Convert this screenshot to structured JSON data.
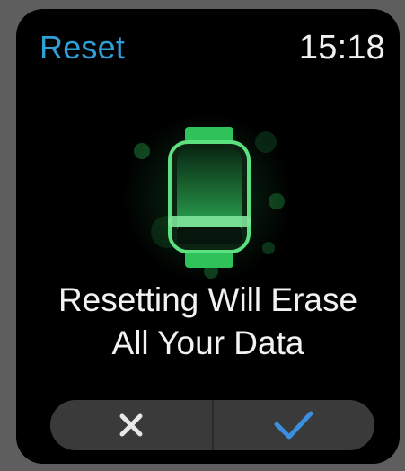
{
  "header": {
    "title": "Reset",
    "time": "15:18"
  },
  "message": {
    "line1": "Resetting Will Erase",
    "line2": "All Your Data"
  },
  "actions": {
    "cancel_icon": "close-icon",
    "confirm_icon": "checkmark-icon"
  },
  "colors": {
    "title": "#2f9fd8",
    "accent_green": "#2fc25a",
    "confirm": "#3a8fe0",
    "cancel": "#e8e8e8"
  },
  "illustration": {
    "icon": "watch-icon"
  }
}
